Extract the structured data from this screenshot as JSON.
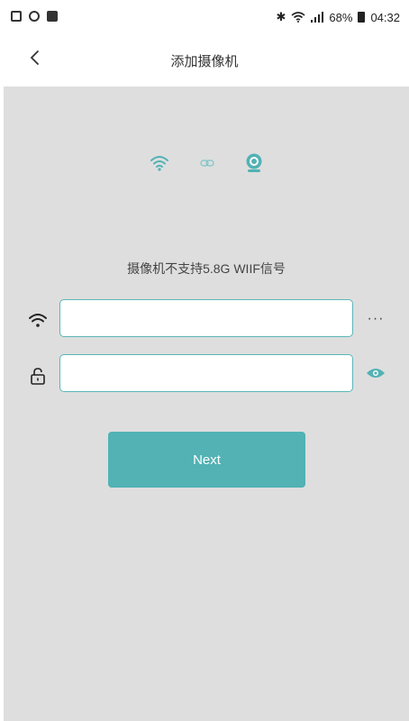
{
  "status_bar": {
    "battery": "68%",
    "time": "04:32"
  },
  "header": {
    "title": "添加摄像机",
    "back_icon": "chevron-left-icon"
  },
  "connect_graphic": {
    "icons": [
      "wifi-icon",
      "link-icon",
      "camera-icon"
    ],
    "accent_color": "#52b2b4"
  },
  "form": {
    "hint": "摄像机不支持5.8G WIIF信号",
    "wifi_name": {
      "value": "",
      "placeholder": "",
      "more_label": "···"
    },
    "wifi_password": {
      "value": "",
      "placeholder": ""
    },
    "next_label": "Next"
  },
  "colors": {
    "accent": "#52b2b4",
    "background": "#dedede",
    "field_border": "#5ab7b9"
  }
}
